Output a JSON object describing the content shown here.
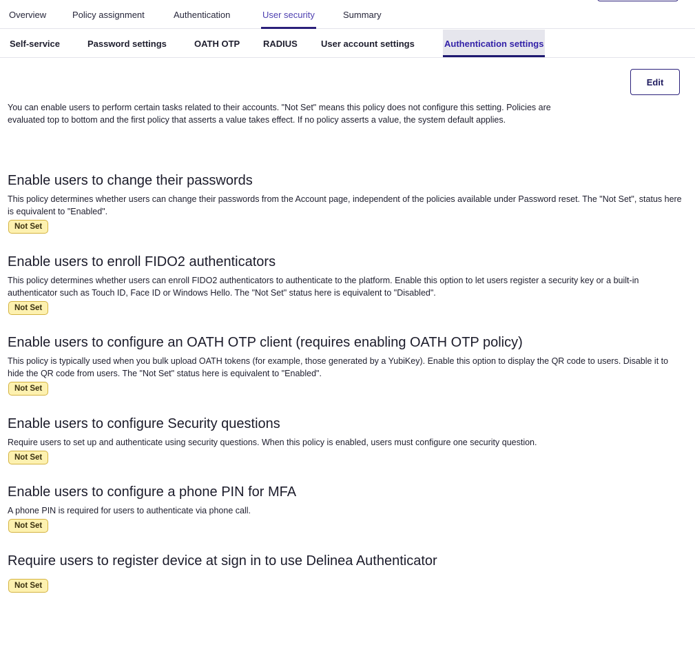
{
  "top_nav": {
    "tabs": [
      {
        "label": "Overview"
      },
      {
        "label": "Policy assignment"
      },
      {
        "label": "Authentication"
      },
      {
        "label": "User security",
        "active": true
      },
      {
        "label": "Summary"
      }
    ]
  },
  "sub_nav": {
    "tabs": [
      {
        "label": "Self-service"
      },
      {
        "label": "Password settings"
      },
      {
        "label": "OATH OTP"
      },
      {
        "label": "RADIUS"
      },
      {
        "label": "User account settings"
      },
      {
        "label": "Authentication settings",
        "active": true
      }
    ]
  },
  "toolbar": {
    "edit_label": "Edit"
  },
  "intro": {
    "text": "You can enable users to perform certain tasks related to their accounts. \"Not Set\" means this policy does not configure this setting. Policies are evaluated top to bottom and the first policy that asserts a value takes effect. If no policy asserts a value, the system default applies."
  },
  "settings": [
    {
      "title": "Enable users to change their passwords",
      "description": "This policy determines whether users can change their passwords from the Account page, independent of the policies available under Password reset. The \"Not Set\", status here is equivalent to \"Enabled\".",
      "status": "Not Set"
    },
    {
      "title": "Enable users to enroll FIDO2 authenticators",
      "description": "This policy determines whether users can enroll FIDO2 authenticators to authenticate to the platform. Enable this option to let users register a security key or a built-in authenticator such as Touch ID, Face ID or Windows Hello. The \"Not Set\" status here is equivalent to \"Disabled\".",
      "status": "Not Set"
    },
    {
      "title": "Enable users to configure an OATH OTP client (requires enabling OATH OTP policy)",
      "description": "This policy is typically used when you bulk upload OATH tokens (for example, those generated by a YubiKey). Enable this option to display the QR code to users. Disable it to hide the QR code from users. The \"Not Set\" status here is equivalent to \"Enabled\".",
      "status": "Not Set"
    },
    {
      "title": "Enable users to configure Security questions",
      "description": "Require users to set up and authenticate using security questions. When this policy is enabled, users must configure one security question.",
      "status": "Not Set"
    },
    {
      "title": "Enable users to configure a phone PIN for MFA",
      "description": "A phone PIN is required for users to authenticate via phone call.",
      "status": "Not Set"
    },
    {
      "title": "Require users to register device at sign in to use Delinea Authenticator",
      "description": "",
      "status": "Not Set"
    }
  ],
  "colors": {
    "accent": "#2a1f7a",
    "active_tab_text": "#4d3fb0",
    "badge_bg": "#fdf1b0",
    "badge_border": "#d4b340"
  }
}
